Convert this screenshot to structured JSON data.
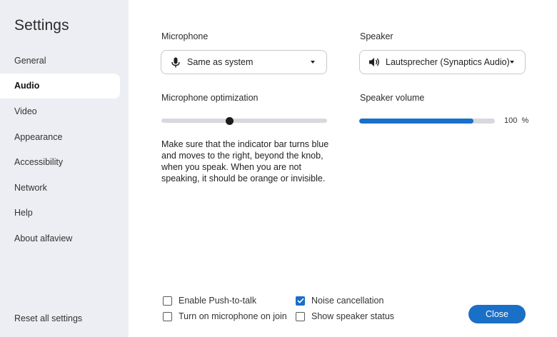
{
  "sidebar": {
    "title": "Settings",
    "items": [
      {
        "label": "General",
        "active": false
      },
      {
        "label": "Audio",
        "active": true
      },
      {
        "label": "Video",
        "active": false
      },
      {
        "label": "Appearance",
        "active": false
      },
      {
        "label": "Accessibility",
        "active": false
      },
      {
        "label": "Network",
        "active": false
      },
      {
        "label": "Help",
        "active": false
      },
      {
        "label": "About alfaview",
        "active": false
      }
    ],
    "reset_label": "Reset all settings"
  },
  "audio": {
    "microphone_label": "Microphone",
    "microphone_value": "Same as system",
    "microphone_icon": "microphone-icon",
    "speaker_label": "Speaker",
    "speaker_value": "Lautsprecher (Synaptics Audio)",
    "speaker_icon": "speaker-icon",
    "mic_optimization_label": "Microphone optimization",
    "mic_optimization_level": 0.41,
    "speaker_volume_label": "Speaker volume",
    "speaker_volume_value": "100",
    "speaker_volume_unit": "%",
    "speaker_volume_fill": 0.84,
    "help_text": "Make sure that the indicator bar turns blue and moves to the right, beyond the knob, when you speak. When you are not speaking, it should be orange or invisible."
  },
  "options": {
    "push_to_talk": {
      "label": "Enable Push-to-talk",
      "checked": false
    },
    "mic_on_join": {
      "label": "Turn on microphone on join",
      "checked": false
    },
    "noise_cancellation": {
      "label": "Noise cancellation",
      "checked": true
    },
    "speaker_status": {
      "label": "Show speaker status",
      "checked": false
    }
  },
  "close_label": "Close",
  "colors": {
    "accent": "#1a6fc7",
    "sidebar_bg": "#edeef3"
  }
}
